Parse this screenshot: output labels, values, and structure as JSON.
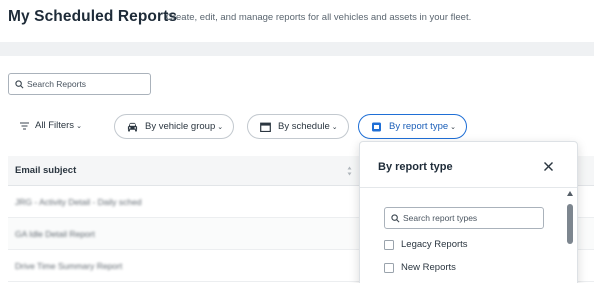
{
  "header": {
    "title": "My Scheduled Reports",
    "subtitle": "Create, edit, and manage reports for all vehicles and assets in your fleet."
  },
  "search": {
    "placeholder": "Search Reports"
  },
  "filters": {
    "all_filters": "All Filters",
    "by_vehicle_group": "By vehicle group",
    "by_schedule": "By schedule",
    "by_report_type": "By report type"
  },
  "table": {
    "column_header": "Email subject",
    "rows": [
      "JRG - Activity Detail - Daily sched",
      "GA Idle Detail Report",
      "Drive Time Summary Report"
    ]
  },
  "dropdown": {
    "title": "By report type",
    "search_placeholder": "Search report types",
    "options": [
      "Legacy Reports",
      "New Reports"
    ]
  },
  "colors": {
    "accent": "#1f6fd6"
  }
}
